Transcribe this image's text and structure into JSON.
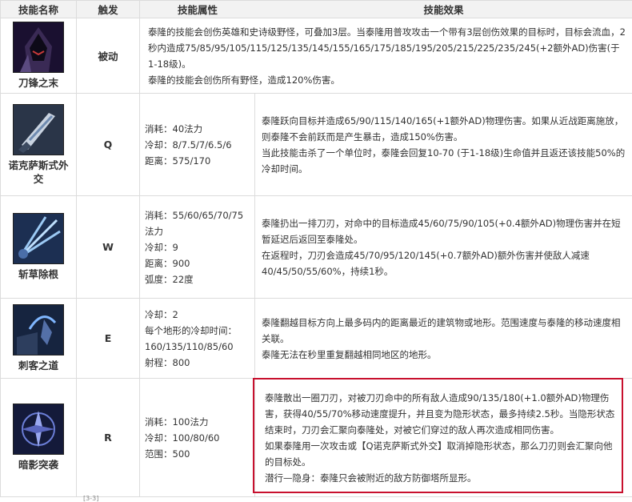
{
  "header": {
    "col_name": "技能名称",
    "col_trigger": "触发",
    "col_attr": "技能属性",
    "col_effect": "技能效果"
  },
  "rows": [
    {
      "name": "刀锋之末",
      "trigger": "被动",
      "icon": "assassin-hood-icon",
      "effect": [
        "泰隆的技能会创伤英雄和史诗级野怪，可叠加3层。当泰隆用普攻攻击一个带有3层创伤效果的目标时，目标会流血，2秒内造成75/85/95/105/115/125/135/145/155/165/175/185/195/205/215/225/235/245(+2额外AD)伤害(于1-18级)。",
        "泰隆的技能会创伤所有野怪，造成120%伤害。"
      ]
    },
    {
      "name": "诺克萨斯式外交",
      "trigger": "Q",
      "icon": "blade-stab-icon",
      "attrs": [
        "消耗：40法力",
        "冷却：8/7.5/7/6.5/6",
        "距离：575/170"
      ],
      "effect": [
        "泰隆跃向目标并造成65/90/115/140/165(+1额外AD)物理伤害。如果从近战距离施放，则泰隆不会前跃而是产生暴击，造成150%伤害。",
        "当此技能击杀了一个单位时，泰隆会回复10-70 (于1-18级)生命值并且返还该技能50%的冷却时间。"
      ]
    },
    {
      "name": "斩草除根",
      "trigger": "W",
      "icon": "blade-fan-icon",
      "attrs": [
        "消耗：55/60/65/70/75法力",
        "冷却：9",
        "距离：900",
        "弧度：22度"
      ],
      "effect": [
        "泰隆扔出一排刀刃，对命中的目标造成45/60/75/90/105(+0.4额外AD)物理伤害并在短暂延迟后返回至泰隆处。",
        "在返程时，刀刃会造成45/70/95/120/145(+0.7额外AD)额外伤害并使敌人减速40/45/50/55/60%，持续1秒。"
      ]
    },
    {
      "name": "刺客之道",
      "trigger": "E",
      "icon": "wall-leap-icon",
      "attrs": [
        "冷却：2",
        "每个地形的冷却时间：160/135/110/85/60",
        "射程：800"
      ],
      "effect": [
        "泰隆翻越目标方向上最多码内的距离最近的建筑物或地形。范围速度与泰隆的移动速度相关联。",
        "泰隆无法在秒里重复翻越相同地区的地形。"
      ]
    },
    {
      "name": "暗影突袭",
      "trigger": "R",
      "icon": "shadow-assault-icon",
      "attrs": [
        "消耗：100法力",
        "冷却：100/80/60",
        "范围：500"
      ],
      "effect": [
        "泰隆散出一圈刀刃，对被刀刃命中的所有敌人造成90/135/180(+1.0额外AD)物理伤害，获得40/55/70%移动速度提升，并且变为隐形状态，最多持续2.5秒。当隐形状态结束时，刀刃会汇聚向泰隆处，对被它们穿过的敌人再次造成相同伤害。",
        "如果泰隆用一次攻击或【Q诺克萨斯式外交】取消掉隐形状态，那么刀刃则会汇聚向他的目标处。",
        "潜行—隐身：泰隆只会被附近的敌方防御塔所显形。"
      ]
    }
  ],
  "footnote": "[3-3]",
  "highlight_color": "#c8102e"
}
